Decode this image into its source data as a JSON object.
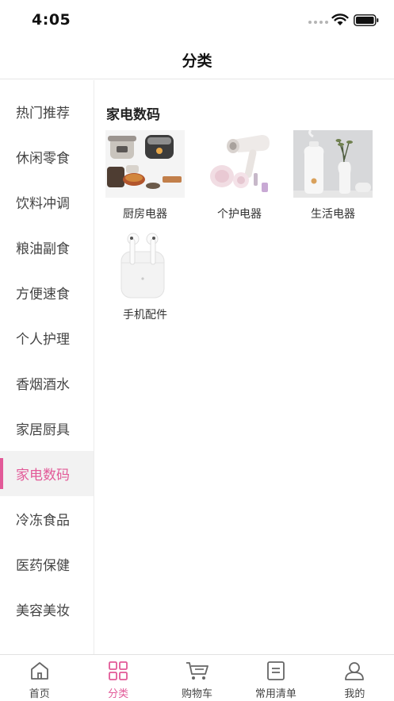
{
  "status": {
    "time": "4:05"
  },
  "nav": {
    "title": "分类"
  },
  "sidebar": {
    "items": [
      {
        "label": "热门推荐"
      },
      {
        "label": "休闲零食"
      },
      {
        "label": "饮料冲调"
      },
      {
        "label": "粮油副食"
      },
      {
        "label": "方便速食"
      },
      {
        "label": "个人护理"
      },
      {
        "label": "香烟酒水"
      },
      {
        "label": "家居厨具"
      },
      {
        "label": "家电数码",
        "active": true
      },
      {
        "label": "冷冻食品"
      },
      {
        "label": "医药保健"
      },
      {
        "label": "美容美妆"
      }
    ]
  },
  "content": {
    "section_title": "家电数码",
    "products": [
      {
        "label": "厨房电器",
        "icon": "kitchen-appliances-image"
      },
      {
        "label": "个护电器",
        "icon": "hair-dryer-image"
      },
      {
        "label": "生活电器",
        "icon": "humidifier-image"
      },
      {
        "label": "手机配件",
        "icon": "earbuds-image"
      }
    ]
  },
  "tabbar": {
    "tabs": [
      {
        "label": "首页",
        "icon": "home-icon"
      },
      {
        "label": "分类",
        "icon": "category-icon",
        "active": true
      },
      {
        "label": "购物车",
        "icon": "cart-icon"
      },
      {
        "label": "常用清单",
        "icon": "list-icon"
      },
      {
        "label": "我的",
        "icon": "profile-icon"
      }
    ]
  },
  "colors": {
    "accent": "#e25a98",
    "text": "#333333",
    "divider": "#e6e6e6"
  }
}
